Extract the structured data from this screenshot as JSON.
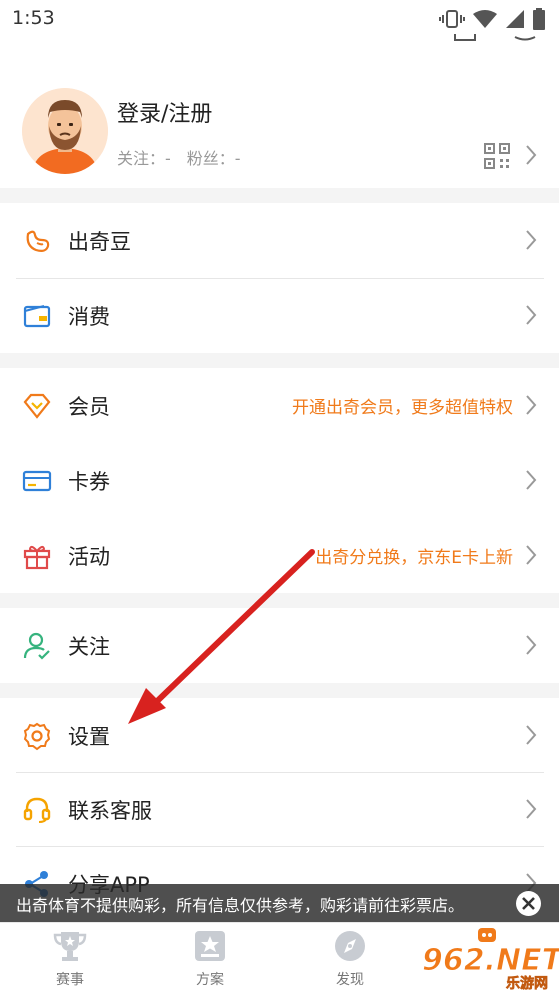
{
  "status_bar": {
    "time": "1:53"
  },
  "profile": {
    "login_label": "登录/注册",
    "follow_label": "关注：-",
    "fans_label": "粉丝：-"
  },
  "menu": {
    "coins": "出奇豆",
    "consume": "消费",
    "member": "会员",
    "member_promo": "开通出奇会员，更多超值特权",
    "coupons": "卡券",
    "events": "活动",
    "events_promo": "出奇分兑换，京东E卡上新",
    "follow": "关注",
    "settings": "设置",
    "support": "联系客服",
    "share": "分享APP"
  },
  "toast": {
    "text": "出奇体育不提供购彩，所有信息仅供参考，购彩请前往彩票店。"
  },
  "tabs": {
    "matches": "赛事",
    "plans": "方案",
    "discover": "发现"
  },
  "watermark": {
    "text": "962.NET",
    "sub": "乐游网"
  },
  "colors": {
    "accent_orange": "#f07a1a",
    "arrow_red": "#d8221f",
    "icon_blue": "#2f80d8",
    "icon_green": "#36b37e",
    "icon_red": "#e04a4a"
  }
}
